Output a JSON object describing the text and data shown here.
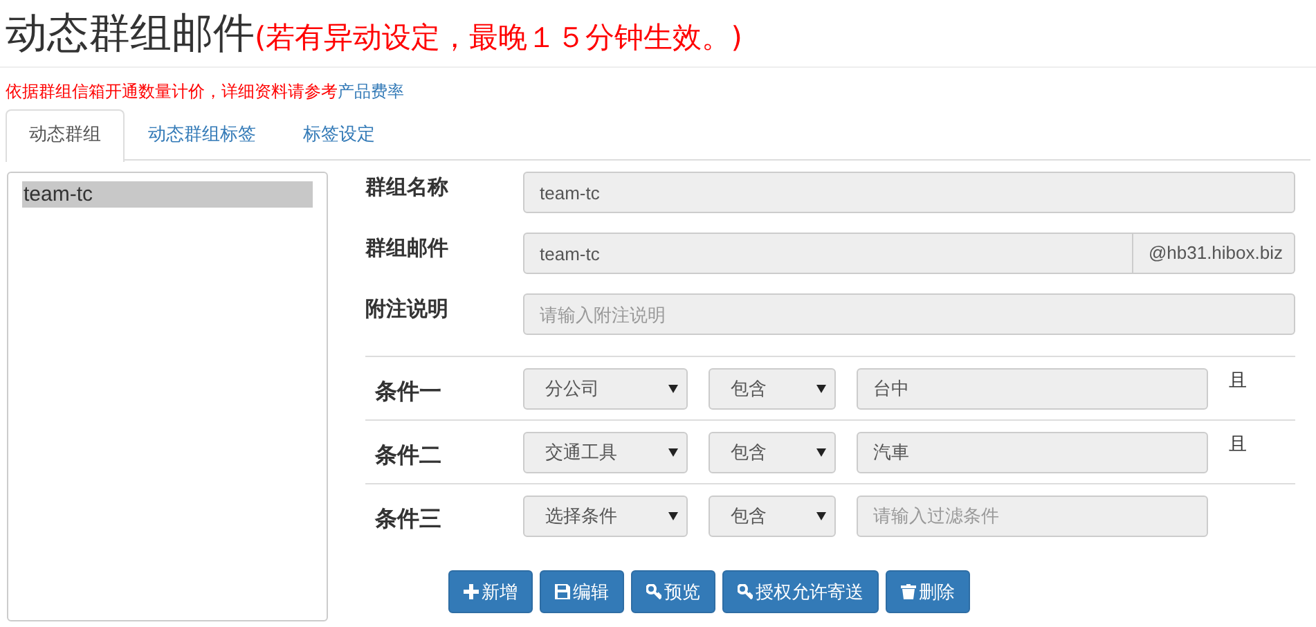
{
  "page_title": "动态群组邮件",
  "title_note": "(若有异动设定，最晚１５分钟生效。)",
  "notice": {
    "text": "依据群组信箱开通数量计价，详细资料请参考",
    "link": "产品费率"
  },
  "tabs": [
    {
      "label": "动态群组",
      "selected": true
    },
    {
      "label": "动态群组标签",
      "selected": false
    },
    {
      "label": "标签设定",
      "selected": false
    }
  ],
  "group_list": [
    {
      "label": "team-tc",
      "selected": true
    }
  ],
  "fields": [
    {
      "label": "群组名称",
      "value": "team-tc"
    },
    {
      "label": "群组邮件",
      "value": "team-tc",
      "suffix": "@hb31.hibox.biz"
    },
    {
      "label": "附注说明",
      "placeholder": "请输入附注说明"
    }
  ],
  "conditions": [
    {
      "label": "条件一",
      "field": "分公司",
      "operator": "包含",
      "value": "台中",
      "joiner": "且"
    },
    {
      "label": "条件二",
      "field": "交通工具",
      "operator": "包含",
      "value": "汽車",
      "joiner": "且"
    },
    {
      "label": "条件三",
      "field": "选择条件",
      "operator": "包含",
      "placeholder": "请输入过滤条件"
    }
  ],
  "buttons": [
    {
      "label": "新增",
      "kind": "add"
    },
    {
      "label": "编辑",
      "kind": "edit"
    },
    {
      "label": "预览",
      "kind": "preview"
    },
    {
      "label": "授权允许寄送",
      "kind": "authorize"
    },
    {
      "label": "删除",
      "kind": "delete"
    }
  ]
}
